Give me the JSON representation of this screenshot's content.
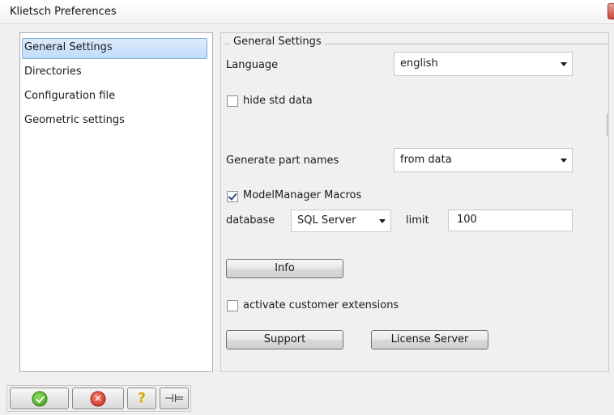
{
  "window": {
    "title": "Klietsch Preferences"
  },
  "nav": {
    "items": [
      {
        "label": "General Settings",
        "selected": true
      },
      {
        "label": "Directories"
      },
      {
        "label": "Configuration file"
      },
      {
        "label": "Geometric settings"
      }
    ]
  },
  "general": {
    "group_title": "General Settings",
    "language": {
      "label": "Language",
      "value": "english"
    },
    "hide_std_data": {
      "label": "hide std data",
      "checked": false
    },
    "part_names": {
      "label": "Generate part names",
      "value": "from data"
    },
    "modelmanager": {
      "label": "ModelManager Macros",
      "checked": true
    },
    "database": {
      "label": "database",
      "value": "SQL Server"
    },
    "limit": {
      "label": "limit",
      "value": "100"
    },
    "info_button": "Info",
    "customer_ext": {
      "label": "activate customer extensions",
      "checked": false
    },
    "support_button": "Support",
    "license_button": "License Server"
  },
  "toolbar": {
    "icons": [
      "ok-icon",
      "cancel-icon",
      "help-icon",
      "pin-icon"
    ],
    "colors": {
      "ok": "#3b9a1c",
      "cancel": "#c6281a",
      "help": "#d8a800"
    }
  }
}
